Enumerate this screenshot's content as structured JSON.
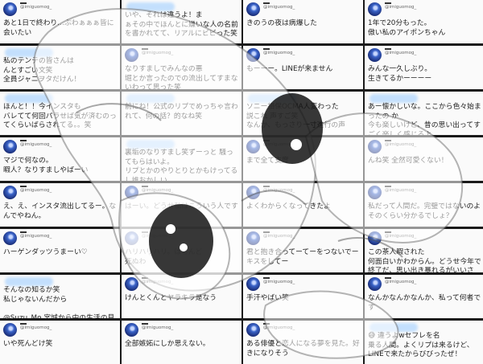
{
  "user_handle": "@imiguomog_",
  "cards": [
    {
      "text": "あと1日で終わり…ぶわぁぁぁ皆に会いたい",
      "avatar": true,
      "high": false
    },
    {
      "text": "いや、それは違うよ！ま\nぁその中でほんとに嫌いな人の名前\nを書かれてて、リアルにビビった笑",
      "avatar": false,
      "high": true
    },
    {
      "text": "きのうの夜は病爆した",
      "avatar": true,
      "high": false
    },
    {
      "text": "1年で20分もった。\n傲い私のアイポンちゃん",
      "avatar": true,
      "high": false
    },
    {
      "text": "私のテンテの皆さんは\nんとすごい文笑\n全員ジャニヲタだけん！",
      "avatar": false,
      "high": true
    },
    {
      "text": "なりすましでみんなの悪\n堀とか言ったのでの流出してすまないわって思った笑",
      "avatar": true,
      "high": false
    },
    {
      "text": "もーーー。LINEが来ません",
      "avatar": true,
      "high": false
    },
    {
      "text": "みんな一久しぶり。\n生きてるかーーーー",
      "avatar": true,
      "high": false
    },
    {
      "text": "ほんと！！今インスタも\nバレてて何回パラせば気が済むのってくらいばらされてる。。笑",
      "avatar": false,
      "high": true
    },
    {
      "text": "前にね！公式のリプでめっちゃ言われて、何の話？的なね笑",
      "avatar": false,
      "high": true
    },
    {
      "text": "ソニー損保OCMA人変わった\n説これ 声すご笑\nなんか、もっさり一寸進行の声",
      "avatar": false,
      "high": true
    },
    {
      "text": "あー懐かしいな。ここから色々始まったの か\n今も楽しいけど、昔の思い出ってすごく楽しく感じるよ",
      "avatar": false,
      "high": true
    },
    {
      "text": "マジで何なの。\n暇人？なりすましやばーい",
      "avatar": true,
      "high": false
    },
    {
      "text": "裏垢のなりすまし笑ずーっと 騒ってもらはいよ。\nリプとかのやりとりとかもけってるし誰おかしい",
      "avatar": false,
      "high": true
    },
    {
      "text": "まで全て支度",
      "avatar": true,
      "high": false
    },
    {
      "text": "んね笑 全然可愛くない！",
      "avatar": true,
      "high": false
    },
    {
      "text": "え、え、インスタ流出してるー。なんでやねん。",
      "avatar": true,
      "high": false
    },
    {
      "text": "はーい。どうせ私はこういう人です",
      "avatar": true,
      "high": false
    },
    {
      "text": "よくわからくなってきたよ",
      "avatar": true,
      "high": false
    },
    {
      "text": "私だって人間だ。完璧ではないのよ\nそのくらい分かるでしょ？",
      "avatar": true,
      "high": false
    },
    {
      "text": "ハーゲンダッツうまーい♡",
      "avatar": true,
      "high": false
    },
    {
      "text": "ハリハリハリ。はぁんど\n死ぬわ",
      "avatar": true,
      "high": false
    },
    {
      "text": "君と抱き合ってーてーをつないでーキスをしてー",
      "avatar": true,
      "high": false
    },
    {
      "text": "この茶人暇された\n何面白いかわからん。どうせ今年で終了だ、思い出き暴れるがいいさ",
      "avatar": true,
      "high": false
    },
    {
      "text": "そんなの知るか笑\n私じゃないんだから\n\n@Suzu_Mo 宮城から中の生活の見方です（笑）",
      "avatar": false,
      "high": true
    },
    {
      "text": "けんとくんとヤラキラ是なう",
      "avatar": true,
      "high": false
    },
    {
      "text": "手汗やばい笑",
      "avatar": true,
      "high": false
    },
    {
      "text": "なんかなんかなんか、私って何者です",
      "avatar": true,
      "high": false
    },
    {
      "text": "いや死んどけ笑",
      "avatar": true,
      "high": false
    },
    {
      "text": "全部嫉妬にしか思えない。",
      "avatar": true,
      "high": false
    },
    {
      "text": "ある俳優と恋人になる夢を見た。好きになりそう",
      "avatar": true,
      "high": false
    },
    {
      "text": "😅 違うよwセフレを名\n乗る人間。よくリプは来るけど、\nLINEで来たからびびったぜ！",
      "avatar": false,
      "high": true
    }
  ]
}
